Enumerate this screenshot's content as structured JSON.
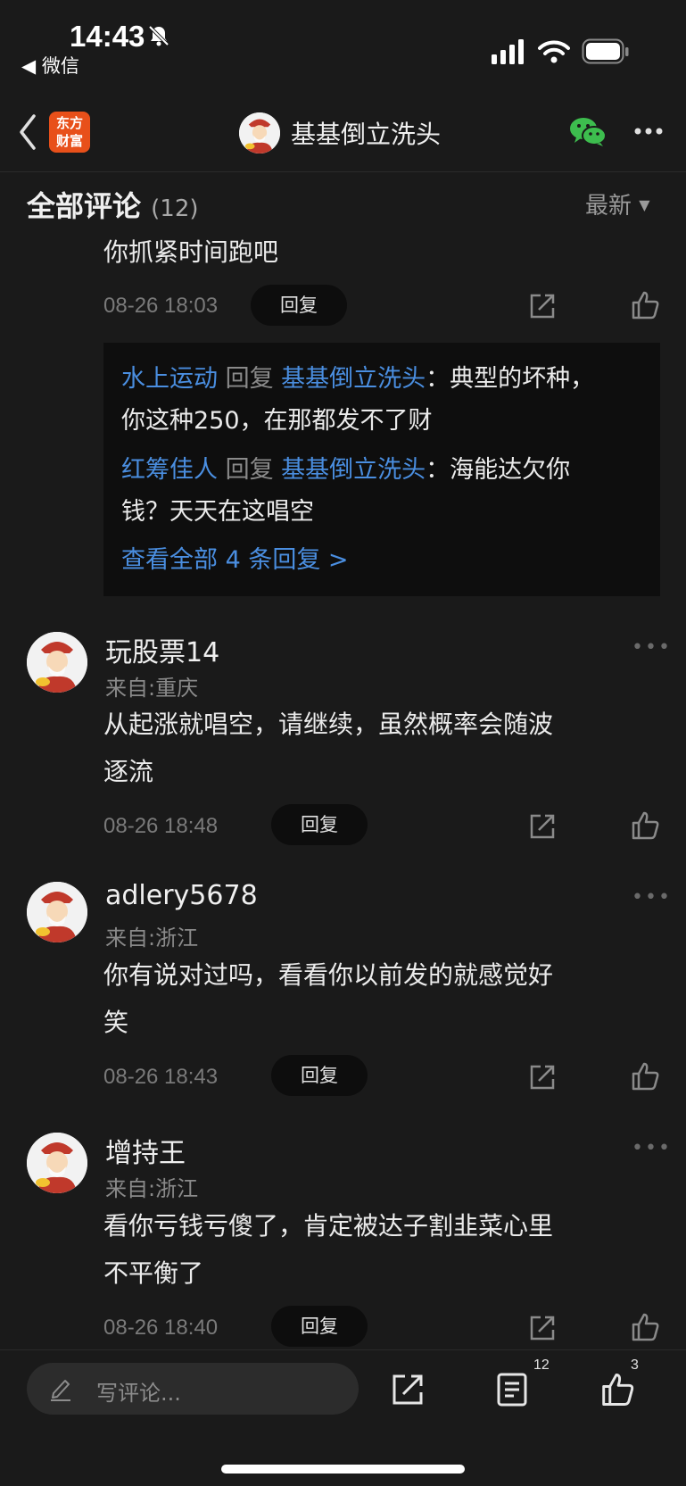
{
  "status_bar": {
    "time": "14:43",
    "back_app": "◀ 微信"
  },
  "nav": {
    "logo_line1": "东方",
    "logo_line2": "财富",
    "title": "基基倒立洗头"
  },
  "section": {
    "title": "全部评论",
    "count": "(12)",
    "sort": "最新"
  },
  "first_comment": {
    "text": "你抓紧时间跑吧",
    "time": "08-26 18:03",
    "reply_label": "回复",
    "sub_replies": [
      {
        "user": "水上运动",
        "sep": " 回复 ",
        "target": "基基倒立洗头",
        "colon": "：",
        "text_a": "典型的坏种，",
        "text_b": "你这种250，在那都发不了财"
      },
      {
        "user": "红筹佳人",
        "sep": " 回复 ",
        "target": "基基倒立洗头",
        "colon": "：",
        "text_a": "海能达欠你",
        "text_b": "钱？天天在这唱空"
      }
    ],
    "view_all": "查看全部 4 条回复 >"
  },
  "comments": [
    {
      "name": "玩股票14",
      "location": "来自:重庆",
      "line1": "从起涨就唱空，请继续，虽然概率会随波",
      "line2": "逐流",
      "time": "08-26 18:48",
      "reply_label": "回复"
    },
    {
      "name": "adlery5678",
      "location": "来自:浙江",
      "line1": "你有说对过吗，看看你以前发的就感觉好",
      "line2": "笑",
      "time": "08-26 18:43",
      "reply_label": "回复"
    },
    {
      "name": "增持王",
      "location": "来自:浙江",
      "line1": "看你亏钱亏傻了，肯定被达子割韭菜心里",
      "line2": "不平衡了",
      "time": "08-26 18:40",
      "reply_label": "回复"
    }
  ],
  "bottom_bar": {
    "placeholder": "写评论...",
    "comment_count": "12",
    "like_count": "3"
  },
  "colors": {
    "background": "#1a1a1a",
    "accent_blue": "#4a8ee0",
    "logo_orange": "#e8501a",
    "wechat_green": "#3dbd4e"
  }
}
